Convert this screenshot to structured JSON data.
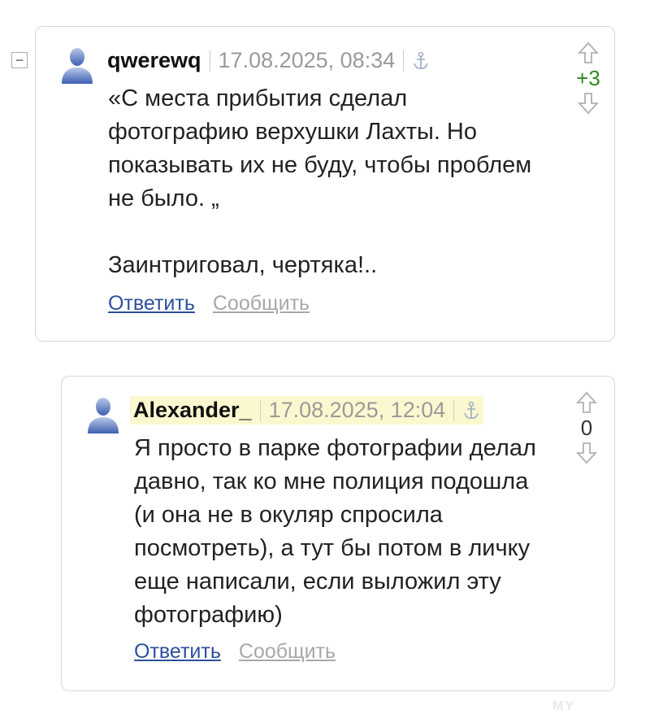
{
  "thread": {
    "collapse_symbol": "−",
    "comments": [
      {
        "author": "qwerewq",
        "date": "17.08.2025, 08:34",
        "rating": "+3",
        "rating_color": "#2e8b1f",
        "text_lines": [
          "«С места прибытия сделал",
          "фотографию верхушки Лахты. Но",
          "показывать их не буду, чтобы проблем",
          "не было. „",
          "",
          "Заинтриговал, чертяка!.."
        ],
        "reply_label": "Ответить",
        "report_label": "Сообщить"
      },
      {
        "author": "Alexander_",
        "date": "17.08.2025, 12:04",
        "rating": "0",
        "rating_color": "#333333",
        "text_lines": [
          "Я просто в парке фотографии делал",
          "давно, так ко мне полиция подошла",
          "(и она не в окуляр спросила",
          "посмотреть), а тут бы потом в личку",
          "еще написали, если выложил эту",
          "фотографию)"
        ],
        "reply_label": "Ответить",
        "report_label": "Сообщить"
      }
    ]
  },
  "icons": {
    "avatar": "user-avatar-icon",
    "anchor": "anchor-link-icon",
    "upvote": "arrow-up-icon",
    "downvote": "arrow-down-icon"
  },
  "watermark": "MY"
}
